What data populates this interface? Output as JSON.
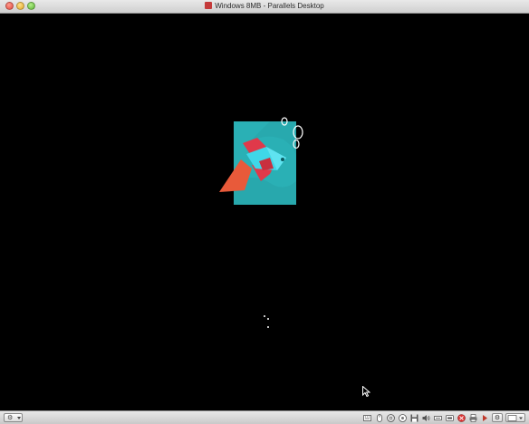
{
  "window": {
    "title": "Windows 8MB - Parallels Desktop",
    "icon": "parallels-vm-icon"
  },
  "vm_screen": {
    "state": "booting",
    "boot_logo": "betta-fish-tile",
    "colors": {
      "background": "#000000",
      "tile": "#2ab0b5",
      "fish_body": "#3fd7e8",
      "fish_fin": "#e0394a",
      "fish_tail": "#e85a3a"
    }
  },
  "statusbar": {
    "menu_icon": "gear-icon",
    "device_icons": [
      "keyboard-icon",
      "mouse-icon",
      "cd-icon",
      "hdd-icon",
      "floppy-icon",
      "speaker-icon",
      "network-icon",
      "usb-icon",
      "shared-folder-icon",
      "printer-icon",
      "play-icon",
      "settings-icon",
      "view-mode-icon"
    ]
  }
}
